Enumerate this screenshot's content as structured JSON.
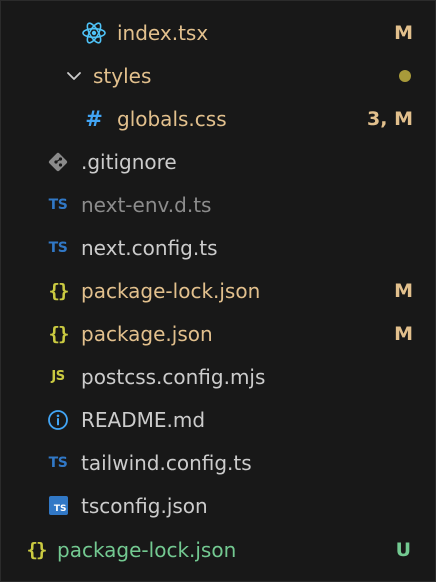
{
  "colors": {
    "background": "#181818",
    "modified": "#e2c08d",
    "untracked": "#73c991",
    "ignored": "#8c8c8c",
    "default_text": "#cccccc",
    "ts_blue": "#3178c6",
    "json_yellow": "#cbcb41",
    "css_blue": "#42a5f5"
  },
  "tree": [
    {
      "name": "index.tsx",
      "icon": "react-icon",
      "badge": "M",
      "status": "modified"
    },
    {
      "name": "styles",
      "icon": "chevron-down-icon",
      "badge": "",
      "status": "modified-folder"
    },
    {
      "name": "globals.css",
      "icon": "hash-icon",
      "icon_text": "#",
      "badge": "3, M",
      "status": "modified"
    },
    {
      "name": ".gitignore",
      "icon": "git-icon",
      "badge": "",
      "status": "default"
    },
    {
      "name": "next-env.d.ts",
      "icon": "typescript-icon",
      "icon_text": "TS",
      "badge": "",
      "status": "ignored"
    },
    {
      "name": "next.config.ts",
      "icon": "typescript-icon",
      "icon_text": "TS",
      "badge": "",
      "status": "default"
    },
    {
      "name": "package-lock.json",
      "icon": "json-icon",
      "icon_text": "{}",
      "badge": "M",
      "status": "modified"
    },
    {
      "name": "package.json",
      "icon": "json-icon",
      "icon_text": "{}",
      "badge": "M",
      "status": "modified"
    },
    {
      "name": "postcss.config.mjs",
      "icon": "javascript-icon",
      "icon_text": "JS",
      "badge": "",
      "status": "default"
    },
    {
      "name": "README.md",
      "icon": "info-icon",
      "icon_text": "i",
      "badge": "",
      "status": "default"
    },
    {
      "name": "tailwind.config.ts",
      "icon": "typescript-icon",
      "icon_text": "TS",
      "badge": "",
      "status": "default"
    },
    {
      "name": "tsconfig.json",
      "icon": "tsconfig-icon",
      "icon_text": "TS",
      "badge": "",
      "status": "default"
    },
    {
      "name": "package-lock.json",
      "icon": "json-icon",
      "icon_text": "{}",
      "badge": "U",
      "status": "untracked"
    }
  ]
}
